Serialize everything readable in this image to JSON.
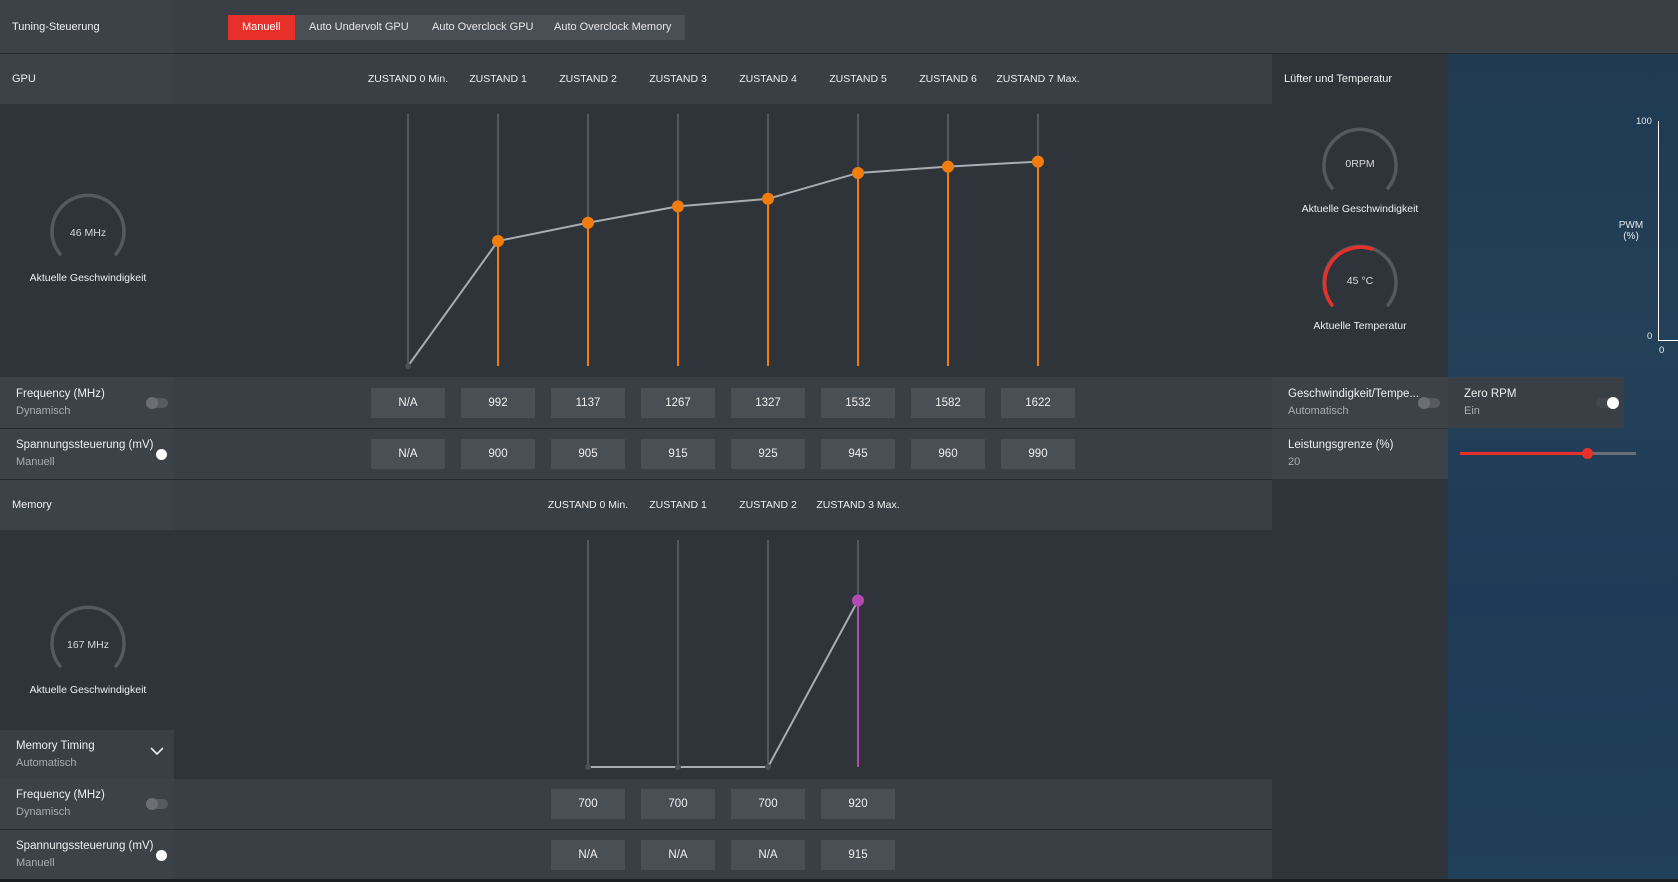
{
  "header": {
    "title": "Tuning-Steuerung",
    "tabs": [
      {
        "label": "Manuell",
        "active": true
      },
      {
        "label": "Auto Undervolt GPU",
        "active": false
      },
      {
        "label": "Auto Overclock GPU",
        "active": false
      },
      {
        "label": "Auto Overclock Memory",
        "active": false
      }
    ]
  },
  "gpu": {
    "title": "GPU",
    "gauge": {
      "value": "46 MHz",
      "label": "Aktuelle Geschwindigkeit"
    },
    "states": [
      "ZUSTAND 0 Min.",
      "ZUSTAND 1",
      "ZUSTAND 2",
      "ZUSTAND 3",
      "ZUSTAND 4",
      "ZUSTAND 5",
      "ZUSTAND 6",
      "ZUSTAND 7 Max."
    ],
    "frequency": {
      "label": "Frequency (MHz)",
      "mode": "Dynamisch",
      "values": [
        "N/A",
        "992",
        "1137",
        "1267",
        "1327",
        "1532",
        "1582",
        "1622"
      ]
    },
    "voltage": {
      "label": "Spannungssteuerung (mV)",
      "mode": "Manuell",
      "values": [
        "N/A",
        "900",
        "905",
        "915",
        "925",
        "945",
        "960",
        "990"
      ]
    }
  },
  "memory": {
    "title": "Memory",
    "gauge": {
      "value": "167 MHz",
      "label": "Aktuelle Geschwindigkeit"
    },
    "states": [
      "ZUSTAND 0 Min.",
      "ZUSTAND 1",
      "ZUSTAND 2",
      "ZUSTAND 3 Max."
    ],
    "timing": {
      "label": "Memory Timing",
      "value": "Automatisch"
    },
    "frequency": {
      "label": "Frequency (MHz)",
      "mode": "Dynamisch",
      "values": [
        "700",
        "700",
        "700",
        "920"
      ]
    },
    "voltage": {
      "label": "Spannungssteuerung (mV)",
      "mode": "Manuell",
      "values": [
        "N/A",
        "N/A",
        "N/A",
        "915"
      ]
    }
  },
  "fan": {
    "title": "Lüfter und Temperatur",
    "speed_gauge": {
      "value": "0RPM",
      "label": "Aktuelle Geschwindigkeit"
    },
    "temp_gauge": {
      "value": "45 °C",
      "label": "Aktuelle Temperatur"
    },
    "pwm_axis": {
      "label_line1": "PWM",
      "label_line2": "(%)",
      "max": "100",
      "min": "0",
      "x0": "0"
    },
    "speed_temp": {
      "label": "Geschwindigkeit/Tempe...",
      "mode": "Automatisch"
    },
    "zero_rpm": {
      "label": "Zero RPM",
      "value": "Ein"
    },
    "power_limit": {
      "label": "Leistungsgrenze (%)",
      "value": "20",
      "fraction": 0.72
    }
  },
  "colors": {
    "accent_red": "#e8302a",
    "gpu_point": "#f27d0c",
    "mem_point": "#b44ab0",
    "curve": "#a9adb2"
  },
  "chart_data": [
    {
      "type": "line",
      "categories": [
        "ZUSTAND 0 Min.",
        "ZUSTAND 1",
        "ZUSTAND 2",
        "ZUSTAND 3",
        "ZUSTAND 4",
        "ZUSTAND 5",
        "ZUSTAND 6",
        "ZUSTAND 7 Max."
      ],
      "series": [
        {
          "values": [
            0,
            992,
            1137,
            1267,
            1327,
            1532,
            1582,
            1622
          ]
        }
      ]
    },
    {
      "type": "line",
      "categories": [
        "ZUSTAND 0 Min.",
        "ZUSTAND 1",
        "ZUSTAND 2",
        "ZUSTAND 3 Max."
      ],
      "series": [
        {
          "values": [
            700,
            700,
            700,
            920
          ]
        }
      ]
    }
  ]
}
